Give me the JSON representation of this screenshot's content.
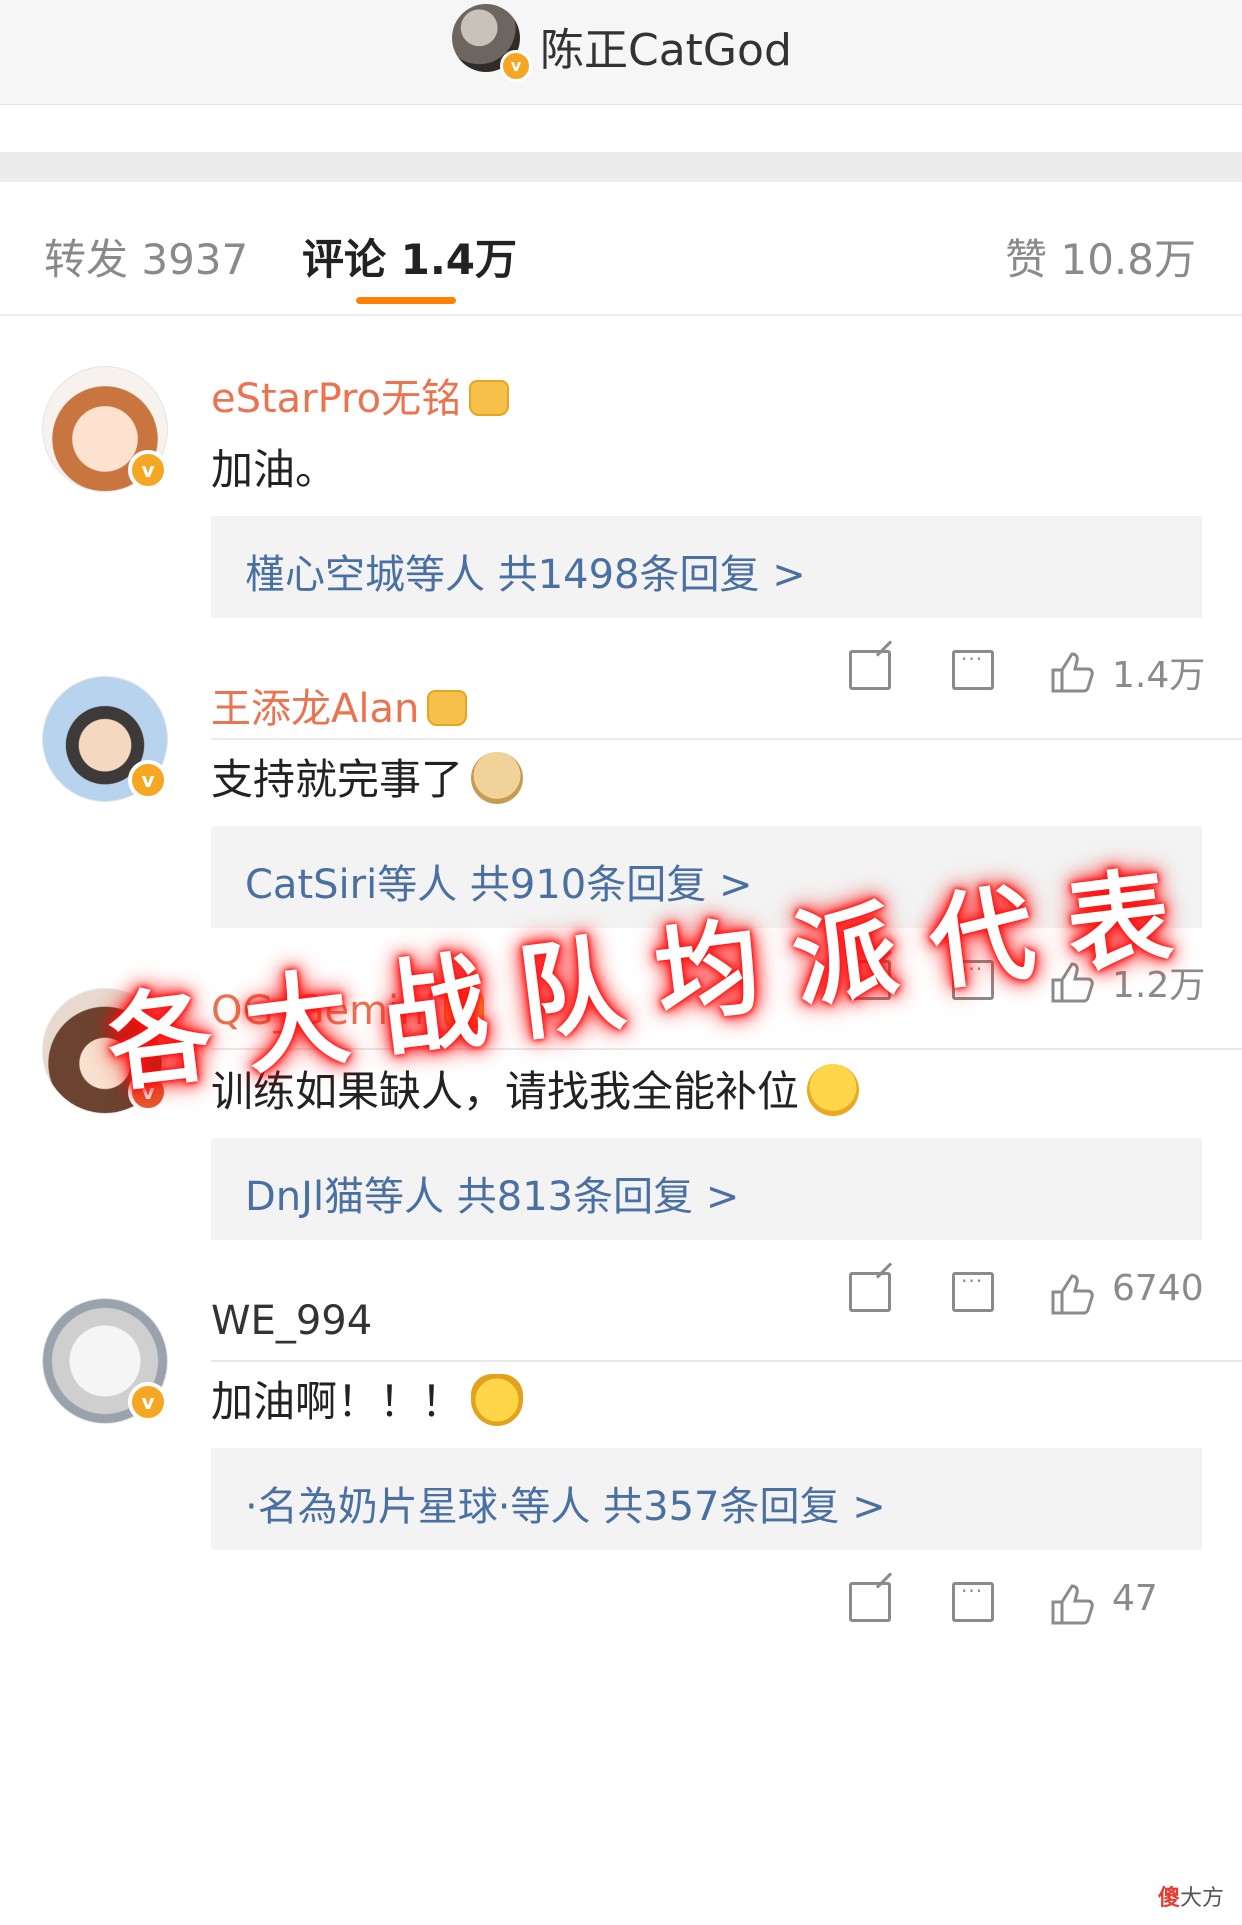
{
  "header": {
    "title": "陈正CatGod",
    "verified_badge": "v"
  },
  "tabs": {
    "repost": "转发 3937",
    "comments": "评论 1.4万",
    "likes": "赞 10.8万"
  },
  "comments": [
    {
      "username": "eStarPro无铭",
      "text": "加油。",
      "replies": "槿心空城等人  共1498条回复 >",
      "like_count": "1.4万",
      "badge": "v",
      "crown": true
    },
    {
      "username": "王添龙Alan",
      "text": "支持就完事了",
      "replies": "CatSiri等人  共910条回复 >",
      "like_count": "1.2万",
      "badge": "v",
      "crown": true
    },
    {
      "username": "QG_Gemini",
      "text": "训练如果缺人，请找我全能补位",
      "replies": "DnJl猫等人  共813条回复 >",
      "like_count": "6740",
      "badge": "v",
      "crown": true
    },
    {
      "username": "WE_994",
      "text": "加油啊！！！",
      "replies": "·名為奶片星球·等人  共357条回复 >",
      "like_count": "47",
      "badge": "v",
      "crown": false
    }
  ],
  "overlay_caption": "各大战队均派代表",
  "watermark": {
    "red_char": "傻",
    "rest": "大方"
  },
  "colors": {
    "accent": "#ff8200",
    "username": "#eb7350",
    "reply_link": "#4a6fa1",
    "badge": "#f5a623"
  }
}
